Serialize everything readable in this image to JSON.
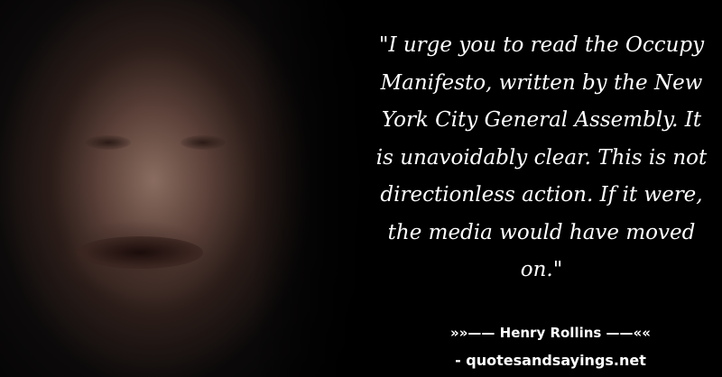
{
  "quote": "\"I urge you to read the Occupy Manifesto, written by the New York City General Assembly. It is unavoidably clear. This is not directionless action. If it were, the media would have moved on.\"",
  "author_line": "»»—— Henry Rollins ——««",
  "website": "- quotesandsayings.net"
}
